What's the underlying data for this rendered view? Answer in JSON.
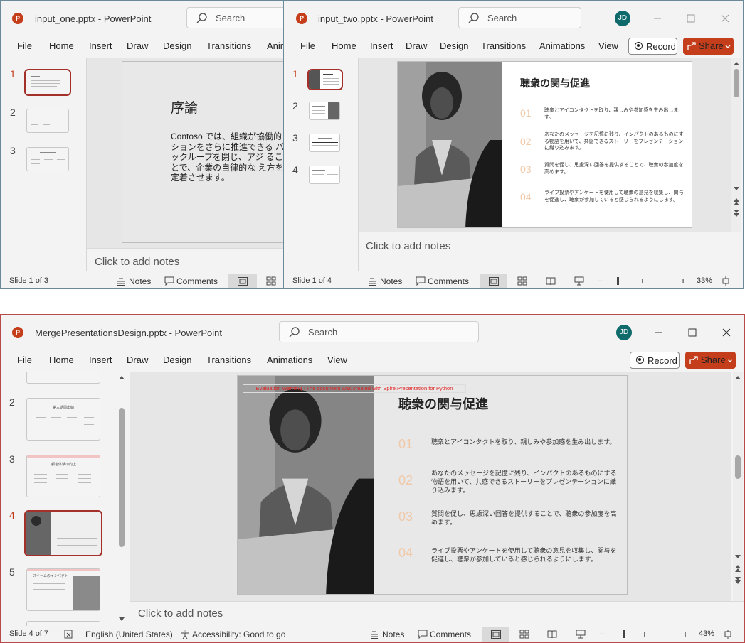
{
  "win1": {
    "title": "input_one.pptx  -  PowerPoint",
    "search_placeholder": "Search",
    "menu": [
      "File",
      "Home",
      "Insert",
      "Draw",
      "Design",
      "Transitions",
      "Anim"
    ],
    "thumb_numbers": [
      "1",
      "2",
      "3"
    ],
    "slide_title": "序論",
    "slide_body": "Contoso では、組織が協働的 ションをさらに推進できる バックループを閉じ、アジ ることで、企業の自律的な え方を定着させます。",
    "notes_placeholder": "Click to add notes",
    "status_slide": "Slide 1 of 3",
    "status_notes": "Notes",
    "status_comments": "Comments"
  },
  "win2": {
    "title": "input_two.pptx  -  PowerPoint",
    "search_placeholder": "Search",
    "avatar": "JD",
    "menu": [
      "File",
      "Home",
      "Insert",
      "Draw",
      "Design",
      "Transitions",
      "Animations",
      "View"
    ],
    "record": "Record",
    "share": "Share",
    "thumb_numbers": [
      "1",
      "2",
      "3",
      "4"
    ],
    "slide_title": "聴衆の関与促進",
    "items": [
      {
        "num": "01",
        "text": "聴衆とアイコンタクトを取り、親しみや参加感を生み出します。"
      },
      {
        "num": "02",
        "text": "あなたのメッセージを記憶に残り、インパクトのあるものにする物語を用いて、共感できるストーリーをプレゼンテーションに織り込みます。"
      },
      {
        "num": "03",
        "text": "質問を促し、思慮深い回答を提供することで、聴衆の参加度を高めます。"
      },
      {
        "num": "04",
        "text": "ライブ投票やアンケートを使用して聴衆の意見を収集し、関与を促進し、聴衆が参加していると感じられるようにします。"
      }
    ],
    "notes_placeholder": "Click to add notes",
    "status_slide": "Slide 1 of 4",
    "status_notes": "Notes",
    "status_comments": "Comments",
    "zoom": "33%"
  },
  "win3": {
    "title": "MergePresentationsDesign.pptx  -  PowerPoint",
    "search_placeholder": "Search",
    "avatar": "JD",
    "menu": [
      "File",
      "Home",
      "Insert",
      "Draw",
      "Design",
      "Transitions",
      "Animations",
      "View"
    ],
    "record": "Record",
    "share": "Share",
    "thumb_numbers": [
      "2",
      "3",
      "4",
      "5"
    ],
    "thumb2_title": "第三期間出納",
    "thumb3_title": "顧客体験の向上",
    "thumb5_title": "スキームのインパクト",
    "eval_warning": "Evaluation Warning : The document was created with Spire.Presentation for Python",
    "slide_title": "聴衆の関与促進",
    "items": [
      {
        "num": "01",
        "text": "聴衆とアイコンタクトを取り、親しみや参加感を生み出します。"
      },
      {
        "num": "02",
        "text": "あなたのメッセージを記憶に残り、インパクトのあるものにする物語を用いて、共感できるストーリーをプレゼンテーションに織り込みます。"
      },
      {
        "num": "03",
        "text": "質問を促し、思慮深い回答を提供することで、聴衆の参加度を高めます。"
      },
      {
        "num": "04",
        "text": "ライブ投票やアンケートを使用して聴衆の意見を収集し、関与を促進し、聴衆が参加していると感じられるようにします。"
      }
    ],
    "notes_placeholder": "Click to add notes",
    "status_slide": "Slide 4 of 7",
    "status_lang": "English (United States)",
    "status_access": "Accessibility: Good to go",
    "status_notes": "Notes",
    "status_comments": "Comments",
    "zoom": "43%"
  }
}
